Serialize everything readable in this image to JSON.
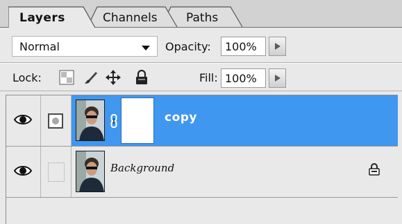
{
  "tabs": [
    {
      "label": "Layers",
      "active": true
    },
    {
      "label": "Channels",
      "active": false
    },
    {
      "label": "Paths",
      "active": false
    }
  ],
  "blend_mode": {
    "selected": "Normal",
    "icon": "chevron-down-icon"
  },
  "opacity": {
    "label": "Opacity:",
    "value": "100%"
  },
  "lock": {
    "label": "Lock:",
    "icons": [
      "lock-transparency-icon",
      "lock-image-brush-icon",
      "lock-position-move-icon",
      "lock-all-padlock-icon"
    ]
  },
  "fill": {
    "label": "Fill:",
    "value": "100%"
  },
  "layers": [
    {
      "name": "copy",
      "visible": true,
      "selected": true,
      "has_mask": true,
      "locked": false
    },
    {
      "name": "Background",
      "visible": true,
      "selected": false,
      "has_mask": false,
      "locked": true
    }
  ],
  "colors": {
    "selection": "#3f97f0",
    "panel": "#e9e9e9"
  }
}
